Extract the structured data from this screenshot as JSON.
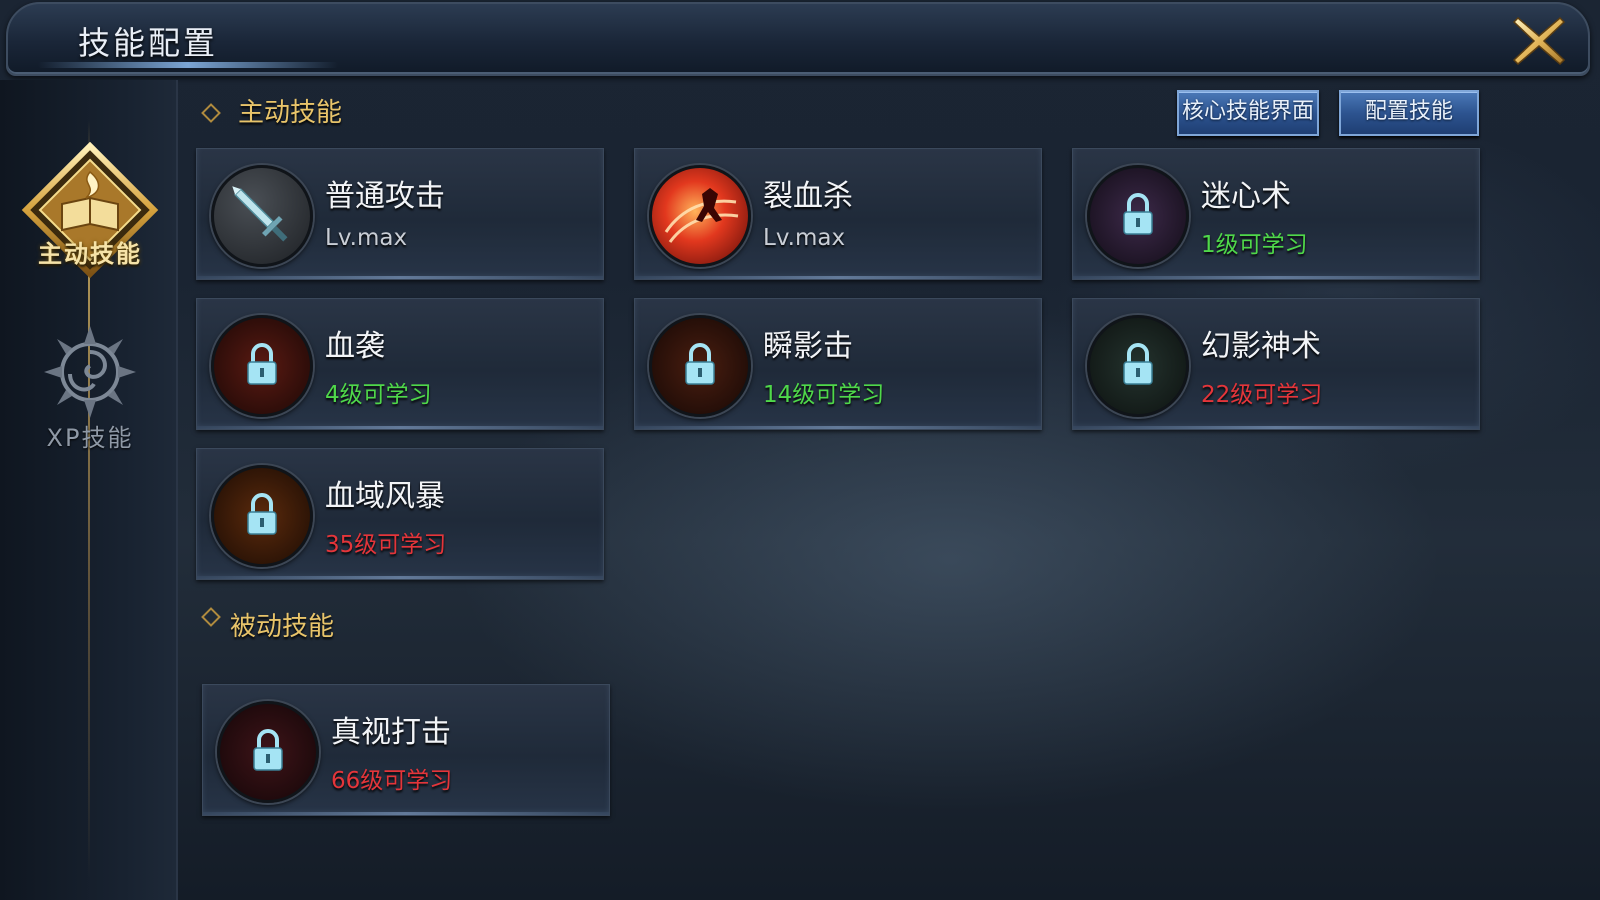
{
  "window": {
    "title": "技能配置"
  },
  "sidebar": {
    "tabs": [
      {
        "label": "主动技能",
        "active": true,
        "icon": "book-flame-emblem-icon"
      },
      {
        "label": "XP技能",
        "active": false,
        "icon": "swirl-emblem-icon"
      }
    ]
  },
  "toolbar": {
    "core_skills_label": "核心技能界面",
    "configure_skills_label": "配置技能"
  },
  "active_section": {
    "title": "主动技能",
    "skills": [
      {
        "name": "普通攻击",
        "status": "Lv.max",
        "status_color": "#c9ced6",
        "locked": false,
        "icon": "sword-icon"
      },
      {
        "name": "裂血杀",
        "status": "Lv.max",
        "status_color": "#c9ced6",
        "locked": false,
        "icon": "blood-slash-icon"
      },
      {
        "name": "迷心术",
        "status": "1级可学习",
        "status_color": "#4fd84a",
        "locked": true,
        "icon": "lock-icon"
      },
      {
        "name": "血袭",
        "status": "4级可学习",
        "status_color": "#4fd84a",
        "locked": true,
        "icon": "lock-icon"
      },
      {
        "name": "瞬影击",
        "status": "14级可学习",
        "status_color": "#4fd84a",
        "locked": true,
        "icon": "lock-icon"
      },
      {
        "name": "幻影神术",
        "status": "22级可学习",
        "status_color": "#e4353a",
        "locked": true,
        "icon": "lock-icon"
      },
      {
        "name": "血域风暴",
        "status": "35级可学习",
        "status_color": "#e4353a",
        "locked": true,
        "icon": "lock-icon"
      }
    ]
  },
  "passive_section": {
    "title": "被动技能",
    "skills": [
      {
        "name": "真视打击",
        "status": "66级可学习",
        "status_color": "#e4353a",
        "locked": true,
        "icon": "lock-icon"
      }
    ]
  },
  "colors": {
    "accent_gold": "#e8c46a",
    "button_blue": "#2d5490",
    "unlock_green": "#4fd84a",
    "locked_red": "#e4353a"
  }
}
